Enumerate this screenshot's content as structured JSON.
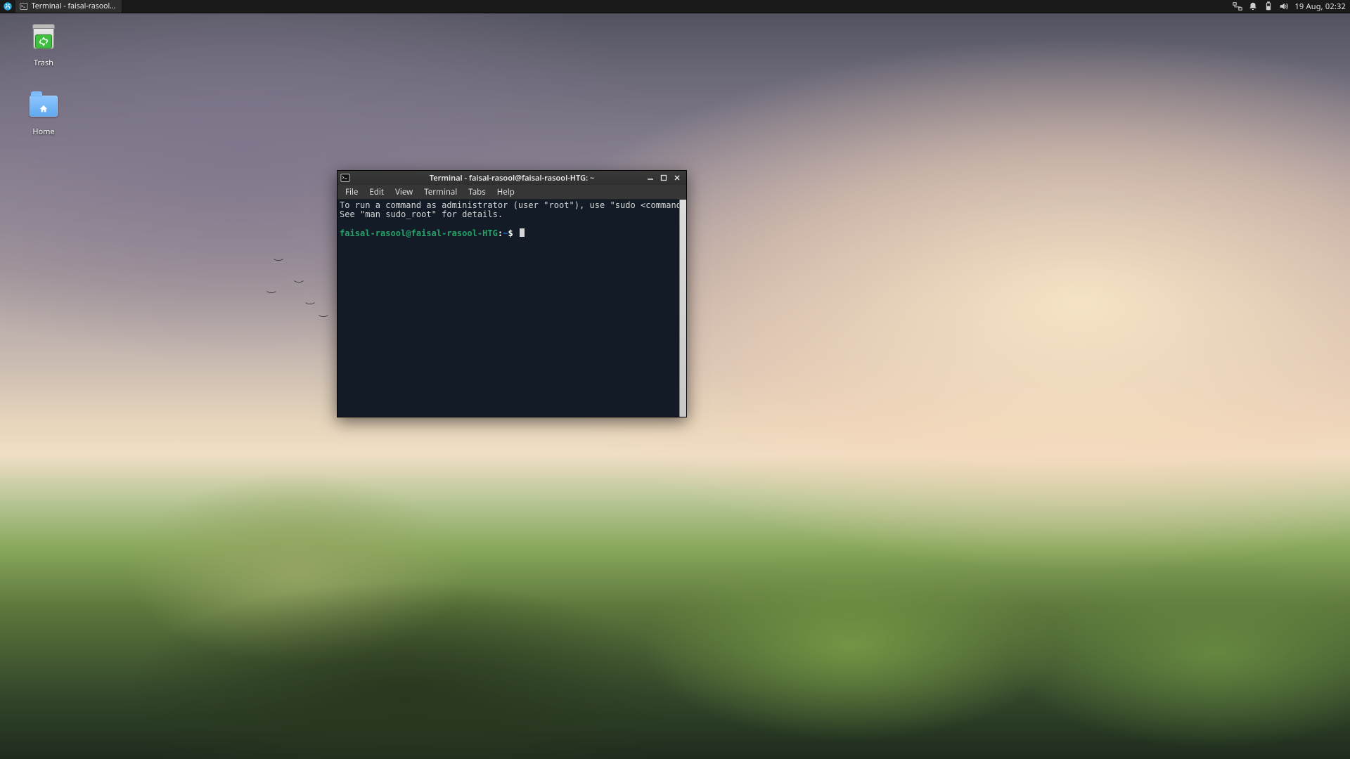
{
  "panel": {
    "task_label": "Terminal - faisal-rasool@fais...",
    "clock": "19 Aug, 02:32"
  },
  "desktop_icons": {
    "trash": "Trash",
    "home": "Home"
  },
  "window": {
    "title": "Terminal - faisal-rasool@faisal-rasool-HTG: ~",
    "menus": [
      "File",
      "Edit",
      "View",
      "Terminal",
      "Tabs",
      "Help"
    ]
  },
  "terminal": {
    "motd_line1": "To run a command as administrator (user \"root\"), use \"sudo <command>\".",
    "motd_line2": "See \"man sudo_root\" for details.",
    "prompt_user_host": "faisal-rasool@faisal-rasool-HTG",
    "prompt_colon": ":",
    "prompt_path": "~",
    "prompt_dollar": "$"
  }
}
